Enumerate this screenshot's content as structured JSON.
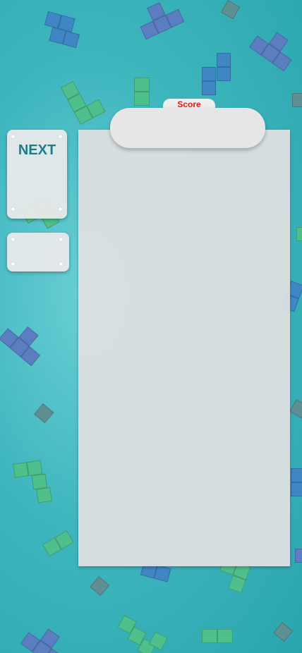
{
  "score": {
    "label": "Score",
    "value": ""
  },
  "next": {
    "title": "NEXT"
  },
  "hold": {
    "title": ""
  },
  "colors": {
    "background": "#3fb6be",
    "score_label": "#e21c1c",
    "next_title": "#1b7d87",
    "board": "#dee0e1",
    "piece_blue": "#3f86c4",
    "piece_green": "#4fbf8b"
  }
}
